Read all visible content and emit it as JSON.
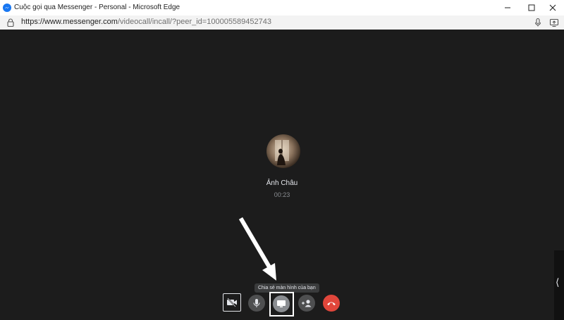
{
  "window": {
    "title": "Cuộc gọi qua Messenger - Personal - Microsoft Edge",
    "app_icon": "messenger-icon",
    "controls": [
      "minimize-icon",
      "maximize-icon",
      "close-icon"
    ]
  },
  "address_bar": {
    "url_host": "https://www.messenger.com",
    "url_path": "/videocall/incall/?peer_id=100005589452743",
    "icons": [
      "lock-icon",
      "microphone-icon",
      "screen-share-icon"
    ]
  },
  "call": {
    "callee_name": "Ảnh Châu",
    "duration": "00:23",
    "tooltip": "Chia sẻ màn hình của bạn",
    "controls": [
      {
        "name": "camera-toggle",
        "icon": "video-off-icon"
      },
      {
        "name": "mute",
        "icon": "microphone-icon"
      },
      {
        "name": "share-screen",
        "icon": "screen-share-icon"
      },
      {
        "name": "add-people",
        "icon": "add-person-icon"
      },
      {
        "name": "end-call",
        "icon": "hang-up-icon"
      }
    ],
    "side_panel_toggle": "⟨"
  },
  "colors": {
    "background": "#1c1c1c",
    "control_gray": "#4e4f50",
    "end_call_red": "#e0463b",
    "text_primary": "#e4e6eb",
    "text_secondary": "#8a8d91"
  }
}
